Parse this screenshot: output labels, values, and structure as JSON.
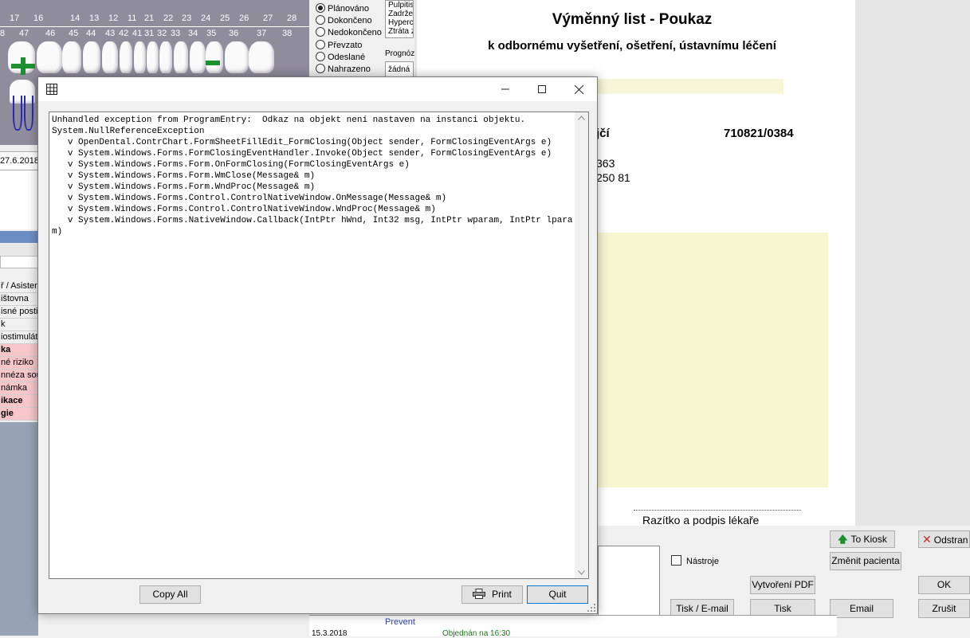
{
  "tooth_chart": {
    "top_numbers": [
      "17",
      "16",
      "14",
      "13",
      "12",
      "11",
      "21",
      "22",
      "23",
      "24",
      "25",
      "26",
      "27",
      "28"
    ],
    "bottom_numbers": [
      "8",
      "47",
      "46",
      "45",
      "44",
      "43",
      "42",
      "41",
      "31",
      "32",
      "33",
      "34",
      "35",
      "36",
      "37",
      "38"
    ]
  },
  "left_panel": {
    "date": "27.6.2018",
    "rows": [
      {
        "text": "ř / Asister",
        "style": "plain"
      },
      {
        "text": "ištovna",
        "style": "plain"
      },
      {
        "text": "isné postiž",
        "style": "plain"
      },
      {
        "text": "k",
        "style": "plain"
      },
      {
        "text": "iostimulát",
        "style": "plain"
      },
      {
        "text": "ka",
        "style": "pink-bold"
      },
      {
        "text": "né riziko",
        "style": "pink"
      },
      {
        "text": "nnéza sou",
        "style": "pink"
      },
      {
        "text": "námka",
        "style": "pink"
      },
      {
        "text": "ikace",
        "style": "pink-bold"
      },
      {
        "text": "gie",
        "style": "pink-bold"
      }
    ]
  },
  "status_radios": [
    {
      "label": "Plánováno",
      "checked": true
    },
    {
      "label": "Dokončeno",
      "checked": false
    },
    {
      "label": "Nedokončeno",
      "checked": false
    },
    {
      "label": "Převzato",
      "checked": false
    },
    {
      "label": "Odeslané",
      "checked": false
    },
    {
      "label": "Nahrazeno",
      "checked": false
    }
  ],
  "diagnosis_list": [
    "Pulpitis",
    "Zadrže",
    "Hyperc",
    "Ztráta z"
  ],
  "prognosis": {
    "label": "Prognóz",
    "value": "žádná"
  },
  "document": {
    "title": "Výměnný list - Poukaz",
    "subtitle": "k odbornému vyšetření, ošetření, ústavnímu léčení",
    "patient_name_fragment": "jčí",
    "patient_id": "710821/0384",
    "line1": "363",
    "line2": "250 81",
    "stamp_label": "Razítko a podpis lékaře"
  },
  "controls": {
    "to_kiosk": "To Kiosk",
    "delete": "Odstran",
    "change_patient": "Změnit pacienta",
    "tools_checkbox": "Nástroje",
    "create_pdf": "Vytvoření PDF",
    "ok": "OK",
    "print_email": "Tisk / E-mail",
    "print": "Tisk",
    "email": "Email",
    "cancel": "Zrušit"
  },
  "bottom_strip": {
    "prevent": "Prevent",
    "date": "15.3.2018",
    "appointment": "Objednán na 16:30"
  },
  "dialog": {
    "error_text": "Unhandled exception from ProgramEntry:  Odkaz na objekt není nastaven na instanci objektu.\nSystem.NullReferenceException\n   v OpenDental.ContrChart.FormSheetFillEdit_FormClosing(Object sender, FormClosingEventArgs e)\n   v System.Windows.Forms.FormClosingEventHandler.Invoke(Object sender, FormClosingEventArgs e)\n   v System.Windows.Forms.Form.OnFormClosing(FormClosingEventArgs e)\n   v System.Windows.Forms.Form.WmClose(Message& m)\n   v System.Windows.Forms.Form.WndProc(Message& m)\n   v System.Windows.Forms.Control.ControlNativeWindow.OnMessage(Message& m)\n   v System.Windows.Forms.Control.ControlNativeWindow.WndProc(Message& m)\n   v System.Windows.Forms.NativeWindow.Callback(IntPtr hWnd, Int32 msg, IntPtr wparam, IntPtr lparam)",
    "copy_all": "Copy All",
    "print": "Print",
    "quit": "Quit"
  },
  "colors": {
    "chart_bg": "#8f8c9c",
    "accent_blue": "#0078d7",
    "highlight_yellow": "#f7f6d1",
    "pink_row": "#f6c6cb"
  }
}
